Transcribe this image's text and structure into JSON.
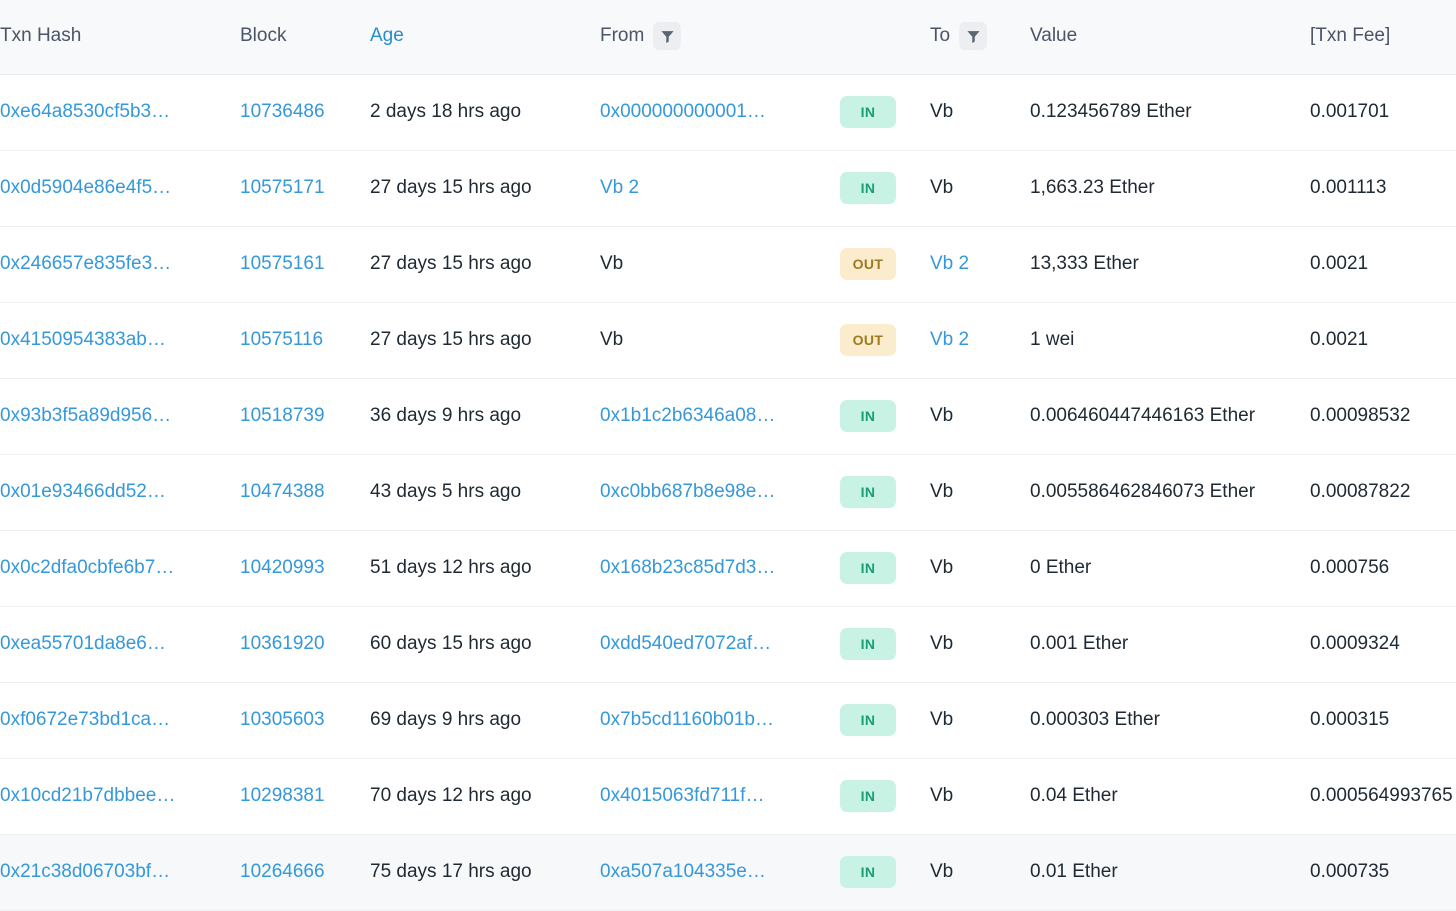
{
  "table": {
    "columns": [
      {
        "key": "hash",
        "label": "Txn Hash",
        "filter": false,
        "link_style": false
      },
      {
        "key": "block",
        "label": "Block",
        "filter": false,
        "link_style": false
      },
      {
        "key": "age",
        "label": "Age",
        "filter": false,
        "link_style": true
      },
      {
        "key": "from",
        "label": "From",
        "filter": true,
        "link_style": false
      },
      {
        "key": "dir",
        "label": "",
        "filter": false,
        "link_style": false
      },
      {
        "key": "to",
        "label": "To",
        "filter": true,
        "link_style": false
      },
      {
        "key": "value",
        "label": "Value",
        "filter": false,
        "link_style": false
      },
      {
        "key": "fee",
        "label": "[Txn Fee]",
        "filter": false,
        "link_style": false
      }
    ],
    "icons": {
      "filter": "filter-funnel-icon"
    },
    "colors": {
      "link": "#3498db",
      "header_link": "#2a8ccc",
      "header_text": "#4a5568",
      "header_bg": "#f8f9fa",
      "row_border": "#edf0f2",
      "row_hover_bg": "#f6f8fa",
      "badge_in_bg": "#c8f3e4",
      "badge_in_text": "#1a9e78",
      "badge_out_bg": "#faeccd",
      "badge_out_text": "#9c7b1c",
      "fee_text": "#9aa3ad"
    },
    "rows": [
      {
        "hash": "0xe64a8530cf5b3…",
        "block": "10736486",
        "age": "2 days 18 hrs ago",
        "from": "0x000000000001…",
        "from_is_link": true,
        "dir": "IN",
        "to": "Vb",
        "to_is_link": false,
        "value": "0.123456789 Ether",
        "fee": "0.001701",
        "hover": false
      },
      {
        "hash": "0x0d5904e86e4f5…",
        "block": "10575171",
        "age": "27 days 15 hrs ago",
        "from": "Vb 2",
        "from_is_link": true,
        "dir": "IN",
        "to": "Vb",
        "to_is_link": false,
        "value": "1,663.23 Ether",
        "fee": "0.001113",
        "hover": false
      },
      {
        "hash": "0x246657e835fe3…",
        "block": "10575161",
        "age": "27 days 15 hrs ago",
        "from": "Vb",
        "from_is_link": false,
        "dir": "OUT",
        "to": "Vb 2",
        "to_is_link": true,
        "value": "13,333 Ether",
        "fee": "0.0021",
        "hover": false
      },
      {
        "hash": "0x4150954383ab…",
        "block": "10575116",
        "age": "27 days 15 hrs ago",
        "from": "Vb",
        "from_is_link": false,
        "dir": "OUT",
        "to": "Vb 2",
        "to_is_link": true,
        "value": "1 wei",
        "fee": "0.0021",
        "hover": false
      },
      {
        "hash": "0x93b3f5a89d956…",
        "block": "10518739",
        "age": "36 days 9 hrs ago",
        "from": "0x1b1c2b6346a08…",
        "from_is_link": true,
        "dir": "IN",
        "to": "Vb",
        "to_is_link": false,
        "value": "0.006460447446163 Ether",
        "fee": "0.00098532",
        "hover": false
      },
      {
        "hash": "0x01e93466dd52…",
        "block": "10474388",
        "age": "43 days 5 hrs ago",
        "from": "0xc0bb687b8e98e…",
        "from_is_link": true,
        "dir": "IN",
        "to": "Vb",
        "to_is_link": false,
        "value": "0.005586462846073 Ether",
        "fee": "0.00087822",
        "hover": false
      },
      {
        "hash": "0x0c2dfa0cbfe6b7…",
        "block": "10420993",
        "age": "51 days 12 hrs ago",
        "from": "0x168b23c85d7d3…",
        "from_is_link": true,
        "dir": "IN",
        "to": "Vb",
        "to_is_link": false,
        "value": "0 Ether",
        "fee": "0.000756",
        "hover": false
      },
      {
        "hash": "0xea55701da8e6…",
        "block": "10361920",
        "age": "60 days 15 hrs ago",
        "from": "0xdd540ed7072af…",
        "from_is_link": true,
        "dir": "IN",
        "to": "Vb",
        "to_is_link": false,
        "value": "0.001 Ether",
        "fee": "0.0009324",
        "hover": false
      },
      {
        "hash": "0xf0672e73bd1ca…",
        "block": "10305603",
        "age": "69 days 9 hrs ago",
        "from": "0x7b5cd1160b01b…",
        "from_is_link": true,
        "dir": "IN",
        "to": "Vb",
        "to_is_link": false,
        "value": "0.000303 Ether",
        "fee": "0.000315",
        "hover": false
      },
      {
        "hash": "0x10cd21b7dbbee…",
        "block": "10298381",
        "age": "70 days 12 hrs ago",
        "from": "0x4015063fd711f…",
        "from_is_link": true,
        "dir": "IN",
        "to": "Vb",
        "to_is_link": false,
        "value": "0.04 Ether",
        "fee": "0.000564993765",
        "hover": false
      },
      {
        "hash": "0x21c38d06703bf…",
        "block": "10264666",
        "age": "75 days 17 hrs ago",
        "from": "0xa507a104335e…",
        "from_is_link": true,
        "dir": "IN",
        "to": "Vb",
        "to_is_link": false,
        "value": "0.01 Ether",
        "fee": "0.000735",
        "hover": true
      }
    ]
  }
}
